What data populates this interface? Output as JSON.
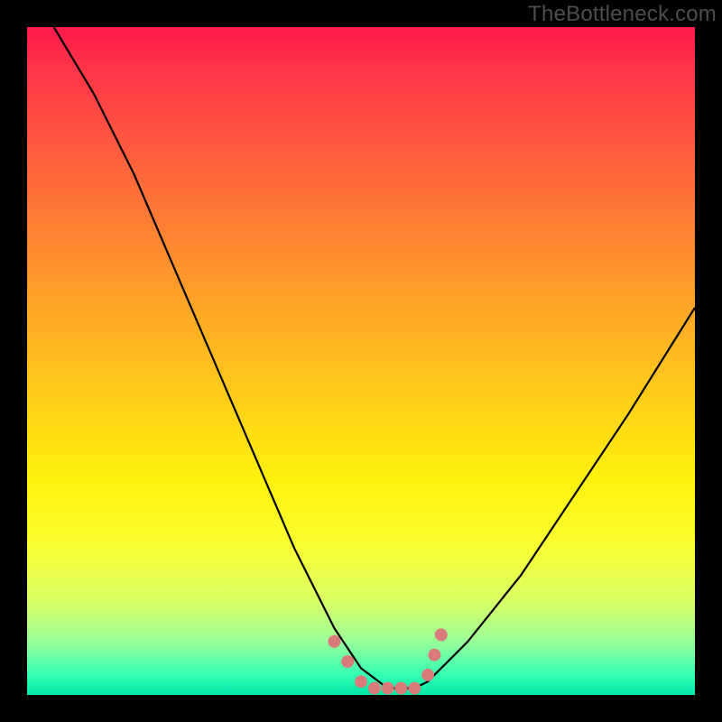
{
  "watermark": "TheBottleneck.com",
  "chart_data": {
    "type": "line",
    "title": "",
    "xlabel": "",
    "ylabel": "",
    "xlim": [
      0,
      100
    ],
    "ylim": [
      0,
      100
    ],
    "series": [
      {
        "name": "bottleneck-curve",
        "x": [
          4,
          10,
          16,
          22,
          28,
          34,
          40,
          46,
          50,
          54,
          58,
          60,
          66,
          74,
          82,
          90,
          100
        ],
        "y": [
          100,
          90,
          78,
          64,
          50,
          36,
          22,
          10,
          4,
          1,
          1,
          2,
          8,
          18,
          30,
          42,
          58
        ]
      }
    ],
    "markers": {
      "name": "highlight-dots",
      "color": "#d97b7b",
      "points": [
        {
          "x": 46,
          "y": 8
        },
        {
          "x": 48,
          "y": 5
        },
        {
          "x": 50,
          "y": 2
        },
        {
          "x": 52,
          "y": 1
        },
        {
          "x": 54,
          "y": 1
        },
        {
          "x": 56,
          "y": 1
        },
        {
          "x": 58,
          "y": 1
        },
        {
          "x": 60,
          "y": 3
        },
        {
          "x": 61,
          "y": 6
        },
        {
          "x": 62,
          "y": 9
        }
      ]
    }
  }
}
